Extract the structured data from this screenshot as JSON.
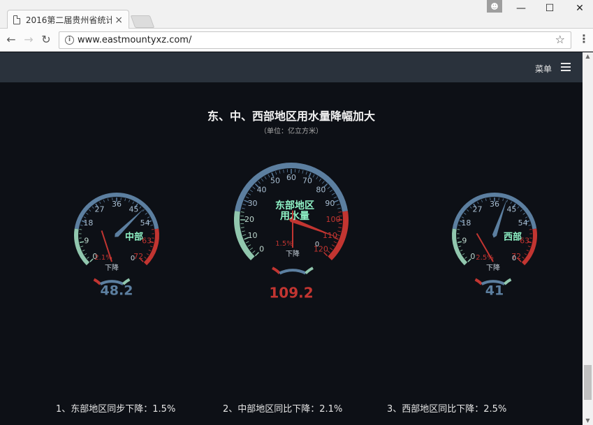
{
  "browser": {
    "tab_title": "2016第二届贵州省统计信",
    "tab_close": "×",
    "url": "www.eastmountyxz.com/",
    "window_controls": {
      "minimize": "—",
      "maximize": "☐",
      "close": "✕"
    }
  },
  "header": {
    "menu_label": "菜单"
  },
  "chart_data": {
    "type": "gauge",
    "title": "东、中、西部地区用水量降幅加大",
    "subtitle": "（单位：亿立方米）",
    "colors": {
      "blue": "#5c7fa0",
      "red": "#c23531",
      "green": "#91c7ae",
      "dark": "#0d1016"
    },
    "gauges": [
      {
        "name": "中部",
        "main": {
          "min": 0,
          "max": 72,
          "ticks": [
            "0",
            "9",
            "18",
            "27",
            "36",
            "45",
            "54",
            "63",
            "72"
          ],
          "value": 48.2,
          "value_label": "48.2"
        },
        "sub": {
          "label": "下降",
          "min": 0,
          "max": 3,
          "ticks": [
            "0"
          ],
          "value": 2.1,
          "value_label": "2.1%"
        }
      },
      {
        "name": "东部地区\n用水量",
        "main": {
          "min": 0,
          "max": 120,
          "ticks": [
            "0",
            "10",
            "20",
            "30",
            "40",
            "50",
            "60",
            "70",
            "80",
            "90",
            "100",
            "110",
            "120"
          ],
          "value": 109.2,
          "value_label": "109.2"
        },
        "sub": {
          "label": "下降",
          "min": 0,
          "max": 3,
          "ticks": [
            "0"
          ],
          "value": 1.5,
          "value_label": "1.5%"
        }
      },
      {
        "name": "西部",
        "main": {
          "min": 0,
          "max": 72,
          "ticks": [
            "0",
            "9",
            "18",
            "27",
            "36",
            "45",
            "54",
            "63",
            "72"
          ],
          "value": 41,
          "value_label": "41"
        },
        "sub": {
          "label": "下降",
          "min": 0,
          "max": 3,
          "ticks": [
            "0"
          ],
          "value": 2.5,
          "value_label": "2.5%"
        }
      }
    ]
  },
  "notes": [
    "1、东部地区同步下降：1.5%",
    "2、中部地区同比下降：2.1%",
    "3、西部地区同比下降：2.5%"
  ]
}
